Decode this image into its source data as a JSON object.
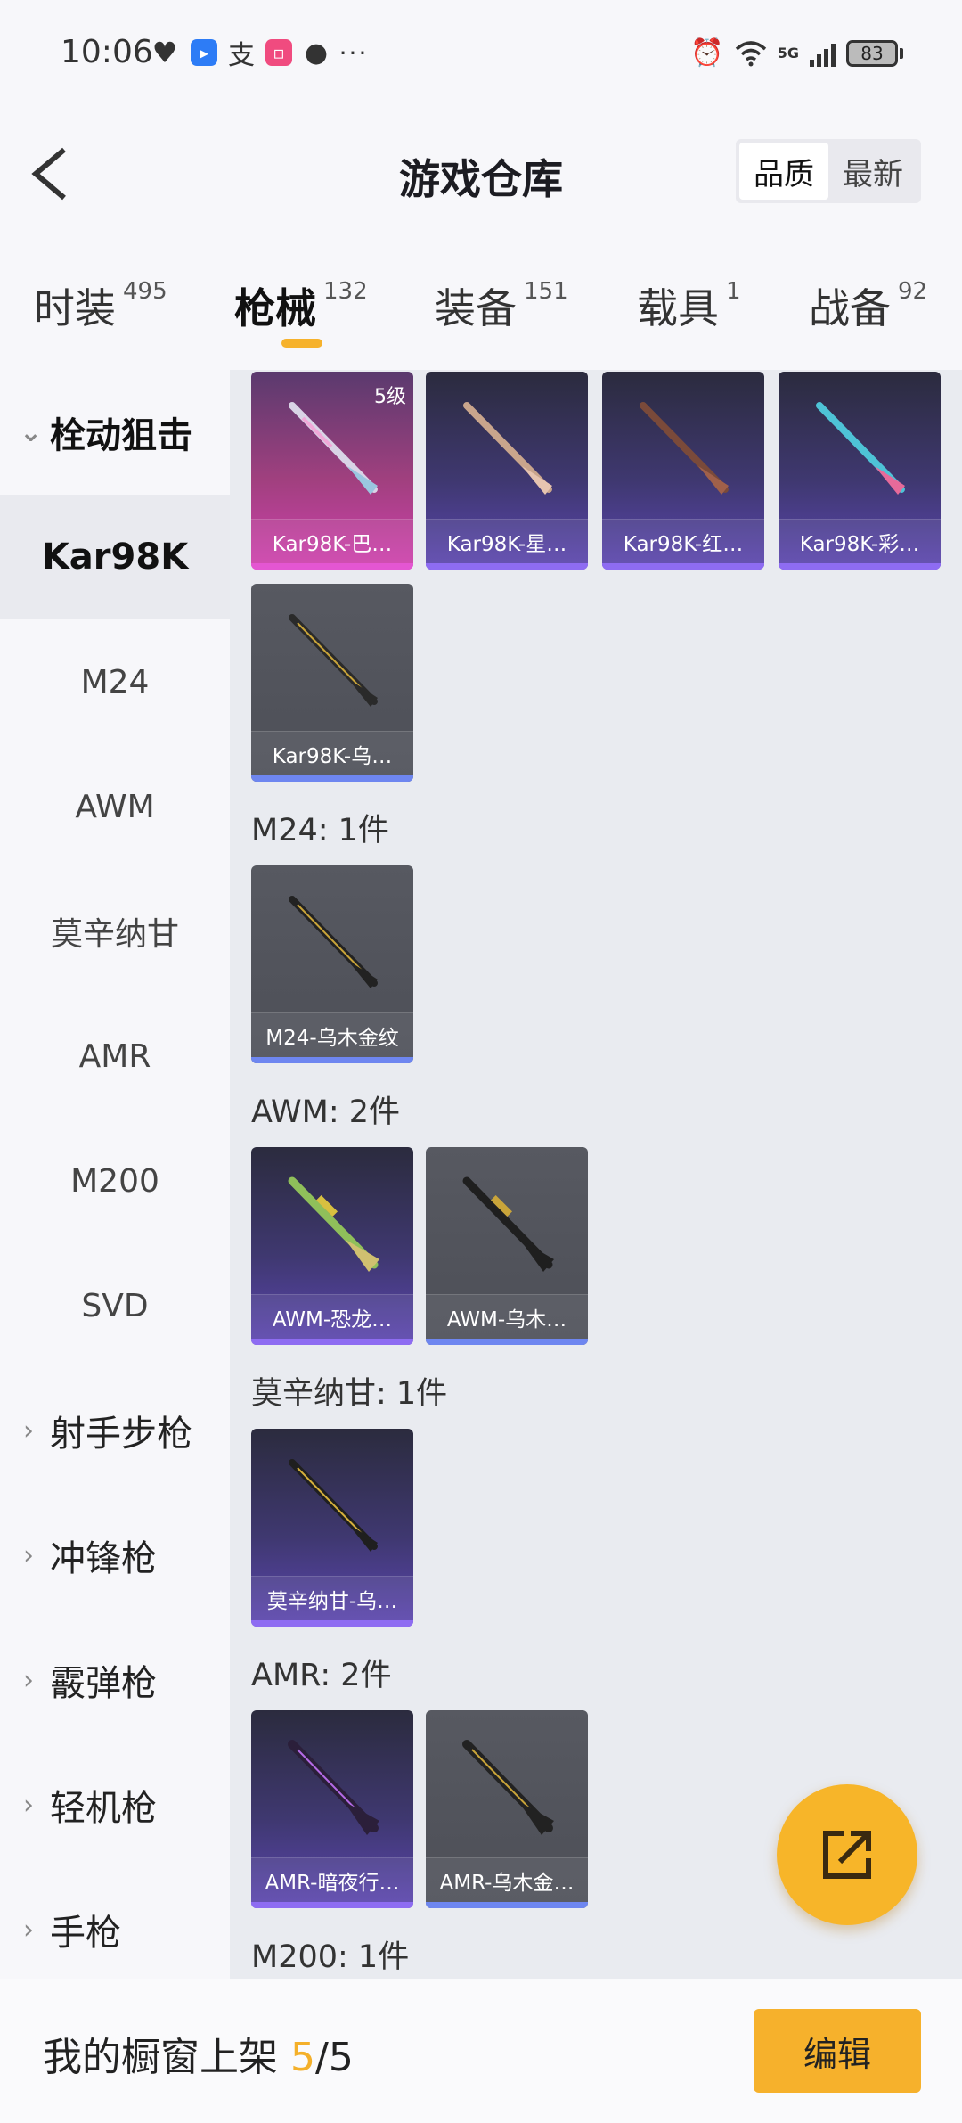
{
  "status_bar": {
    "time": "10:06",
    "left_icons": [
      "heart-icon",
      "app-icon",
      "alipay-icon",
      "bilibili-icon",
      "chat-icon",
      "more-dots-icon"
    ],
    "network": "5G",
    "battery": "83"
  },
  "header": {
    "title": "游戏仓库",
    "sort_options": [
      "品质",
      "最新"
    ],
    "active_sort": "品质"
  },
  "tabs": [
    {
      "label": "时装",
      "count": "495"
    },
    {
      "label": "枪械",
      "count": "132"
    },
    {
      "label": "装备",
      "count": "151"
    },
    {
      "label": "载具",
      "count": "1"
    },
    {
      "label": "战备",
      "count": "92"
    }
  ],
  "active_tab": "枪械",
  "sidebar": {
    "items": [
      {
        "label": "栓动狙击",
        "type": "group",
        "open": true
      },
      {
        "label": "Kar98K",
        "type": "sub",
        "active": true
      },
      {
        "label": "M24",
        "type": "sub"
      },
      {
        "label": "AWM",
        "type": "sub"
      },
      {
        "label": "莫辛纳甘",
        "type": "sub"
      },
      {
        "label": "AMR",
        "type": "sub"
      },
      {
        "label": "M200",
        "type": "sub"
      },
      {
        "label": "SVD",
        "type": "sub"
      },
      {
        "label": "射手步枪",
        "type": "group"
      },
      {
        "label": "冲锋枪",
        "type": "group"
      },
      {
        "label": "霰弹枪",
        "type": "group"
      },
      {
        "label": "轻机枪",
        "type": "group"
      },
      {
        "label": "手枪",
        "type": "group"
      }
    ]
  },
  "sections": [
    {
      "title": "",
      "items": [
        {
          "name": "Kar98K-巴…",
          "quality": "pink",
          "level": "5级"
        },
        {
          "name": "Kar98K-星…",
          "quality": "purple"
        },
        {
          "name": "Kar98K-红…",
          "quality": "purple"
        },
        {
          "name": "Kar98K-彩…",
          "quality": "purple"
        },
        {
          "name": "Kar98K-乌…",
          "quality": "gray"
        }
      ]
    },
    {
      "title": "M24: 1件",
      "items": [
        {
          "name": "M24-乌木金纹",
          "quality": "gray"
        }
      ]
    },
    {
      "title": "AWM: 2件",
      "items": [
        {
          "name": "AWM-恐龙…",
          "quality": "purple"
        },
        {
          "name": "AWM-乌木…",
          "quality": "gray"
        }
      ]
    },
    {
      "title": "莫辛纳甘: 1件",
      "items": [
        {
          "name": "莫辛纳甘-乌…",
          "quality": "purple"
        }
      ]
    },
    {
      "title": "AMR: 2件",
      "items": [
        {
          "name": "AMR-暗夜行…",
          "quality": "purple"
        },
        {
          "name": "AMR-乌木金…",
          "quality": "gray"
        }
      ]
    },
    {
      "title": "M200: 1件",
      "items": []
    }
  ],
  "fab": {
    "icon": "share-icon"
  },
  "bottom_bar": {
    "label": "我的橱窗上架",
    "used": "5",
    "separator": "/",
    "total": "5",
    "edit_label": "编辑"
  },
  "colors": {
    "accent": "#f6b22c",
    "quality_pink": "#e456d2",
    "quality_purple": "#8e6cf2",
    "quality_gray": "#6e86f0"
  }
}
